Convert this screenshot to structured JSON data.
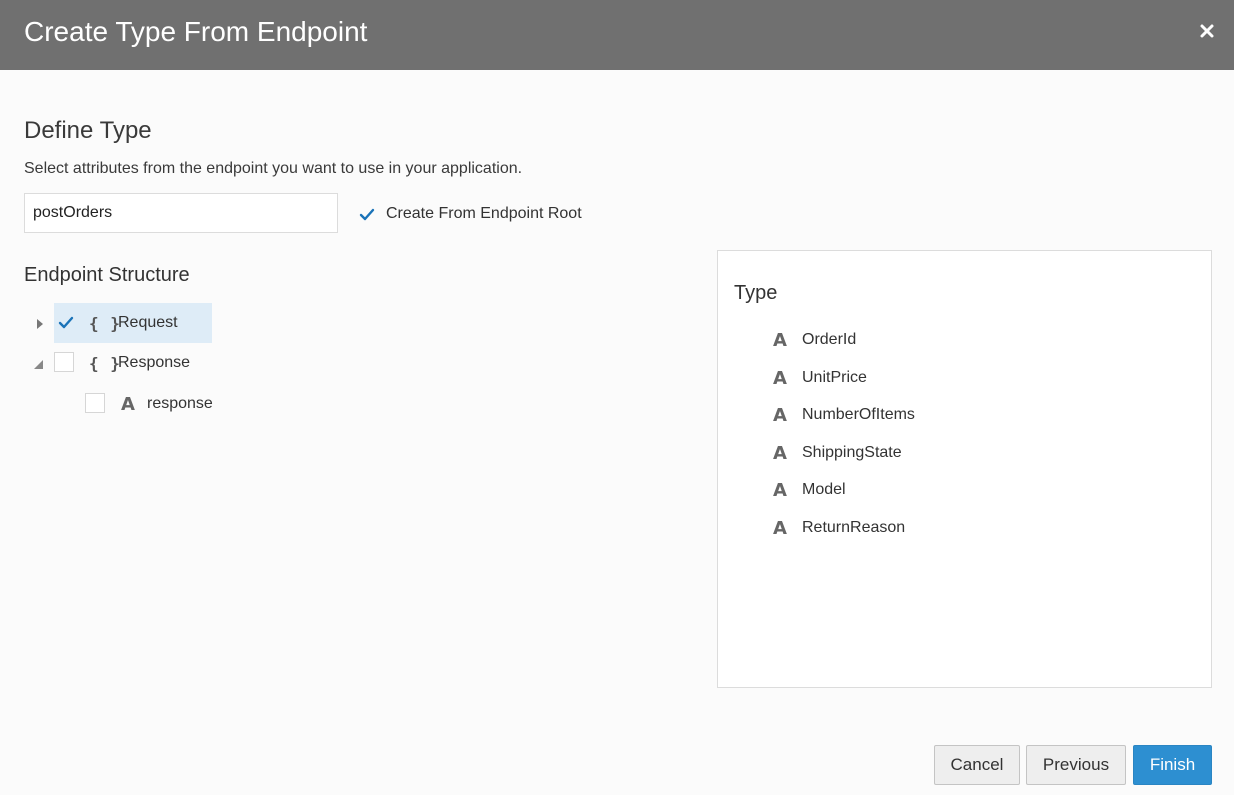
{
  "dialog": {
    "title": "Create Type From Endpoint"
  },
  "define_type": {
    "heading": "Define Type",
    "instructions": "Select attributes from the endpoint you want to use in your application.",
    "name_value": "postOrders",
    "create_from_root_label": "Create From Endpoint Root",
    "create_from_root_checked": true
  },
  "endpoint_structure": {
    "heading": "Endpoint Structure",
    "nodes": [
      {
        "label": "Request",
        "glyph": "{ }",
        "icon": "object-icon",
        "checked": true,
        "expanded": false
      },
      {
        "label": "Response",
        "glyph": "{ }",
        "icon": "object-icon",
        "checked": false,
        "expanded": true
      },
      {
        "label": "response",
        "glyph": "A",
        "icon": "string-attribute-icon",
        "checked": false
      }
    ]
  },
  "type_panel": {
    "heading": "Type",
    "attributes": [
      {
        "label": "OrderId",
        "glyph": "A",
        "icon": "string-attribute-icon"
      },
      {
        "label": "UnitPrice",
        "glyph": "A",
        "icon": "string-attribute-icon"
      },
      {
        "label": "NumberOfItems",
        "glyph": "A",
        "icon": "string-attribute-icon"
      },
      {
        "label": "ShippingState",
        "glyph": "A",
        "icon": "string-attribute-icon"
      },
      {
        "label": "Model",
        "glyph": "A",
        "icon": "string-attribute-icon"
      },
      {
        "label": "ReturnReason",
        "glyph": "A",
        "icon": "string-attribute-icon"
      }
    ]
  },
  "footer": {
    "cancel_label": "Cancel",
    "previous_label": "Previous",
    "finish_label": "Finish"
  },
  "colors": {
    "titlebar": "#707070",
    "accent": "#2d8fd1",
    "selection": "#deecf7",
    "check": "#1a73b8"
  }
}
